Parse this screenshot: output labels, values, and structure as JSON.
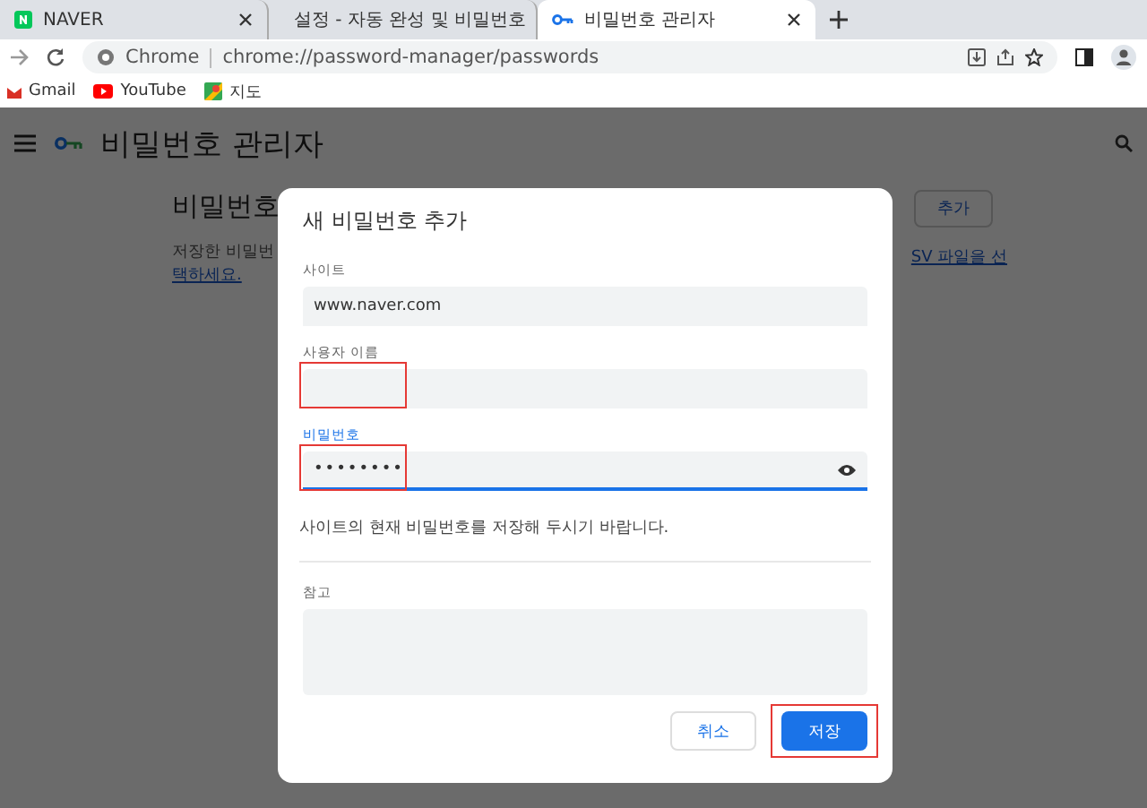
{
  "tabs": [
    {
      "label": "NAVER",
      "selected": false
    },
    {
      "label": "설정 - 자동 완성 및 비밀번호",
      "selected": false
    },
    {
      "label": "비밀번호 관리자",
      "selected": true
    }
  ],
  "address_bar": {
    "origin": "Chrome",
    "url": "chrome://password-manager/passwords"
  },
  "bookmarks": [
    {
      "label": "Gmail"
    },
    {
      "label": "YouTube"
    },
    {
      "label": "지도"
    }
  ],
  "app_bar": {
    "title": "비밀번호 관리자"
  },
  "background_page": {
    "heading": "비밀번호",
    "add_button": "추가",
    "description_left": [
      "저장한 비밀번",
      "택하세요."
    ],
    "description_right": "SV 파일을 선"
  },
  "dialog": {
    "title": "새 비밀번호 추가",
    "fields": [
      {
        "kind": "text",
        "label": "사이트",
        "value": "www.naver.com",
        "focused": false,
        "highlighted": false
      },
      {
        "kind": "text",
        "label": "사용자 이름",
        "focused": false,
        "highlighted": true
      },
      {
        "kind": "password",
        "label": "비밀번호",
        "value": "••••••••",
        "focused": true,
        "highlighted": true
      }
    ],
    "hint": "사이트의 현재 비밀번호를 저장해 두시기 바랍니다.",
    "note": {
      "label": "참고"
    },
    "buttons": [
      {
        "label": "취소",
        "kind": "secondary",
        "highlighted": false
      },
      {
        "label": "저장",
        "kind": "primary",
        "highlighted": true
      }
    ]
  }
}
